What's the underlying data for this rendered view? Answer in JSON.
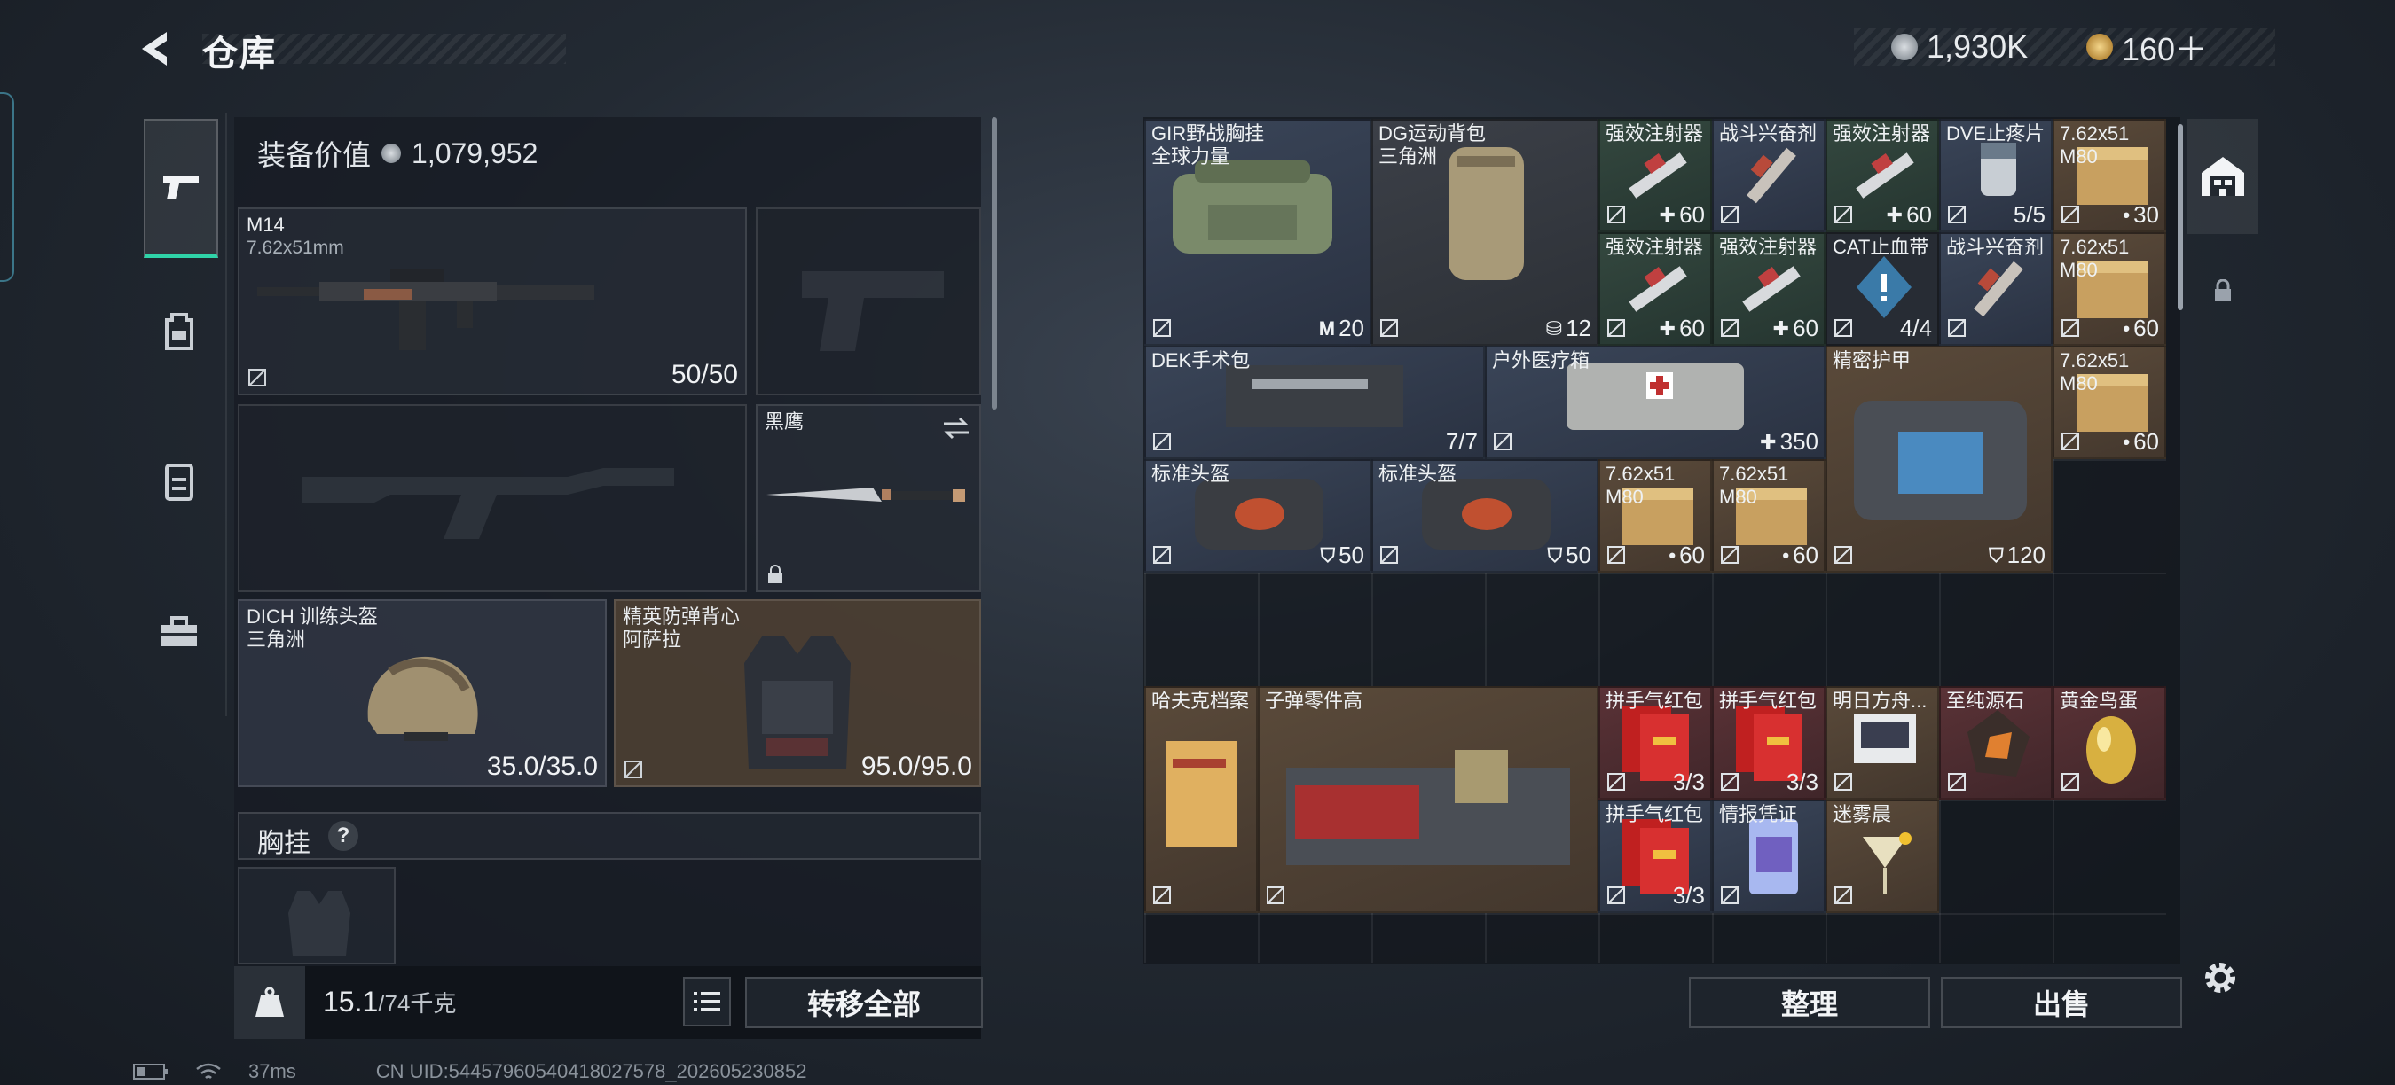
{
  "header": {
    "title": "仓库",
    "currency1": "1,930K",
    "currency2": "160＋"
  },
  "equipment": {
    "value_label": "装备价值",
    "value": "1,079,952",
    "primary": {
      "name": "M14",
      "caliber": "7.62x51mm",
      "ammo": "50/50"
    },
    "melee": {
      "name": "黑鹰"
    },
    "helmet": {
      "name": "DICH 训练头盔",
      "origin": "三角洲",
      "durability": "35.0/35.0"
    },
    "armor": {
      "name": "精英防弹背心",
      "origin": "阿萨拉",
      "durability": "95.0/95.0"
    },
    "chest_rig": {
      "label": "胸挂",
      "help": "?"
    }
  },
  "footer": {
    "weight": "15.1",
    "weight_max": "/74千克",
    "transfer_all": "转移全部",
    "organize": "整理",
    "sell": "出售"
  },
  "stash_items": [
    {
      "name": "GIR野战胸挂",
      "sub": "全球力量",
      "count": "20",
      "badge": "M"
    },
    {
      "name": "DG运动背包",
      "sub": "三角洲",
      "count": "12"
    },
    {
      "name": "强效注射器",
      "count": "60"
    },
    {
      "name": "战斗兴奋剂",
      "count": ""
    },
    {
      "name": "强效注射器",
      "count": "60"
    },
    {
      "name": "DVE止疼片",
      "count": "5/5"
    },
    {
      "name": "7.62x51",
      "sub": "M80",
      "count": "30"
    },
    {
      "name": "强效注射器",
      "count": "60"
    },
    {
      "name": "强效注射器",
      "count": "60"
    },
    {
      "name": "CAT止血带",
      "count": "4/4"
    },
    {
      "name": "战斗兴奋剂",
      "count": ""
    },
    {
      "name": "7.62x51",
      "sub": "M80",
      "count": "60"
    },
    {
      "name": "DEK手术包",
      "count": "7/7"
    },
    {
      "name": "户外医疗箱",
      "count": "350"
    },
    {
      "name": "精密护甲",
      "count": "120"
    },
    {
      "name": "7.62x51",
      "sub": "M80",
      "count": "60"
    },
    {
      "name": "标准头盔",
      "count": "50"
    },
    {
      "name": "标准头盔",
      "count": "50"
    },
    {
      "name": "7.62x51",
      "sub": "M80",
      "count": "60"
    },
    {
      "name": "7.62x51",
      "sub": "M80",
      "count": "60"
    },
    {
      "name": "哈夫克档案",
      "count": ""
    },
    {
      "name": "子弹零件高",
      "count": ""
    },
    {
      "name": "拼手气红包",
      "count": "3/3"
    },
    {
      "name": "拼手气红包",
      "count": "3/3"
    },
    {
      "name": "明日方舟...",
      "count": ""
    },
    {
      "name": "至纯源石",
      "count": ""
    },
    {
      "name": "黄金鸟蛋",
      "count": ""
    },
    {
      "name": "拼手气红包",
      "count": "3/3"
    },
    {
      "name": "情报凭证",
      "count": ""
    },
    {
      "name": "迷雾晨",
      "count": ""
    }
  ],
  "status_bar": {
    "ping": "37ms",
    "uid": "CN UID:54457960540418027578_202605230852"
  },
  "colors": {
    "accent_green": "#2fd3a8",
    "rarity_blue": "#3a4558",
    "rarity_green": "#34483f",
    "rarity_gold": "#5a4a3a",
    "rarity_red": "#5a3236"
  }
}
